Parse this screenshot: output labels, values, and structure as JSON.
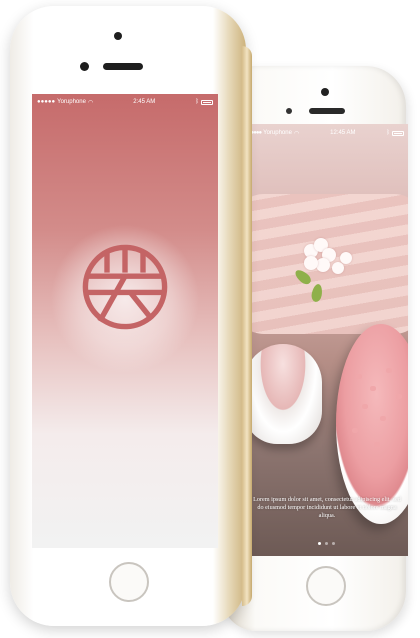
{
  "front_phone": {
    "status_bar": {
      "carrier": "Yoruphone",
      "time": "2:45 AM"
    },
    "colors": {
      "screen_top": "#c66b6b",
      "logo": "#c46465"
    }
  },
  "back_phone": {
    "status_bar": {
      "carrier": "Yoruphone",
      "time": "12:45 AM"
    },
    "caption": "Lorem ipsum dolor sit amet, consectetur adipiscing elit, sed do eiusmod tempor incididunt ut labore et dolore magna aliqua.",
    "pagination": {
      "pages": 3,
      "active": 1
    }
  }
}
